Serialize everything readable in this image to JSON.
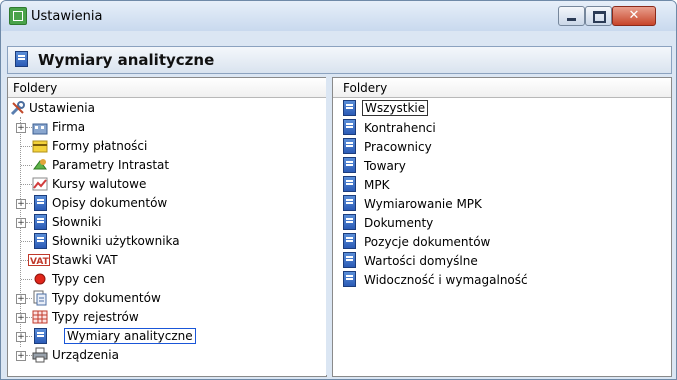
{
  "window": {
    "title": "Ustawienia"
  },
  "header": {
    "title": "Wymiary analityczne"
  },
  "left_panel": {
    "header": "Foldery",
    "root": "Ustawienia",
    "items": [
      {
        "label": "Firma",
        "icon": "building-icon",
        "expandable": true
      },
      {
        "label": "Formy płatności",
        "icon": "payment-icon",
        "expandable": false
      },
      {
        "label": "Parametry Intrastat",
        "icon": "intrastat-icon",
        "expandable": false
      },
      {
        "label": "Kursy walutowe",
        "icon": "chart-icon",
        "expandable": false
      },
      {
        "label": "Opisy dokumentów",
        "icon": "document-icon",
        "expandable": true
      },
      {
        "label": "Słowniki",
        "icon": "document-icon",
        "expandable": true
      },
      {
        "label": "Słowniki użytkownika",
        "icon": "document-icon",
        "expandable": false
      },
      {
        "label": "Stawki VAT",
        "icon": "vat-icon",
        "expandable": false
      },
      {
        "label": "Typy cen",
        "icon": "red-dot-icon",
        "expandable": false
      },
      {
        "label": "Typy dokumentów",
        "icon": "doc-type-icon",
        "expandable": true
      },
      {
        "label": "Typy rejestrów",
        "icon": "grid-icon",
        "expandable": true
      },
      {
        "label": "Wymiary analityczne",
        "icon": "document-icon",
        "expandable": true,
        "selected": true
      },
      {
        "label": "Urządzenia",
        "icon": "printer-icon",
        "expandable": true
      }
    ]
  },
  "right_panel": {
    "header": "Foldery",
    "items": [
      {
        "label": "Wszystkie",
        "selected": true
      },
      {
        "label": "Kontrahenci"
      },
      {
        "label": "Pracownicy"
      },
      {
        "label": "Towary"
      },
      {
        "label": "MPK"
      },
      {
        "label": "Wymiarowanie MPK"
      },
      {
        "label": "Dokumenty"
      },
      {
        "label": "Pozycje dokumentów"
      },
      {
        "label": "Wartości domyślne"
      },
      {
        "label": "Widoczność i wymagalność"
      }
    ]
  },
  "colors": {
    "selection_border": "#1a56d8",
    "window_bg": "#dbe6f3",
    "doc_icon": "#2b5bb6"
  }
}
